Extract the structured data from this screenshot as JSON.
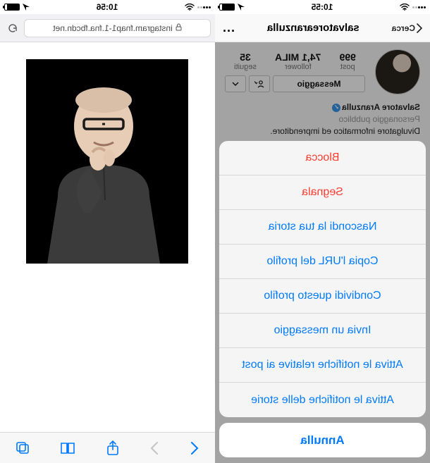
{
  "left": {
    "status": {
      "time": "10:55",
      "signal": 3,
      "loc": true,
      "wifi": true,
      "battery_pct": 85
    },
    "nav": {
      "back_label": "Cerca",
      "title": "salvatorearanzulla",
      "more_label": "..."
    },
    "profile": {
      "stats": {
        "posts_value": "999",
        "posts_label": "post",
        "followers_value": "74,1 MILA",
        "followers_label": "follower",
        "following_value": "35",
        "following_label": "seguiti"
      },
      "message_btn": "Messaggio",
      "follow_icon": "person-check-icon",
      "dropdown_icon": "chevron-down-icon",
      "name": "Salvatore Aranzulla",
      "category": "Personaggio pubblico",
      "bio_line": "Divulgatore informatico ed imprenditore."
    },
    "sheet": {
      "items": [
        {
          "label": "Blocca",
          "style": "destructive"
        },
        {
          "label": "Segnala",
          "style": "destructive"
        },
        {
          "label": "Nascondi la tua storia",
          "style": "normal"
        },
        {
          "label": "Copia l'URL del profilo",
          "style": "normal"
        },
        {
          "label": "Condividi questo profilo",
          "style": "normal"
        },
        {
          "label": "Invia un messaggio",
          "style": "normal"
        },
        {
          "label": "Attiva le notifiche relative ai post",
          "style": "normal"
        },
        {
          "label": "Attiva le notifiche delle storie",
          "style": "normal"
        }
      ],
      "cancel": "Annulla"
    }
  },
  "right": {
    "status": {
      "time": "10:56",
      "signal": 3,
      "loc": true,
      "wifi": true,
      "battery_pct": 85
    },
    "url": {
      "host": "instagram.fnap1-1.fna.fbcdn.net",
      "secure": true
    },
    "toolbar": {
      "back": "chevron-left-icon",
      "forward": "chevron-right-icon",
      "share": "share-icon",
      "bookmarks": "book-icon",
      "tabs": "tabs-icon"
    }
  }
}
